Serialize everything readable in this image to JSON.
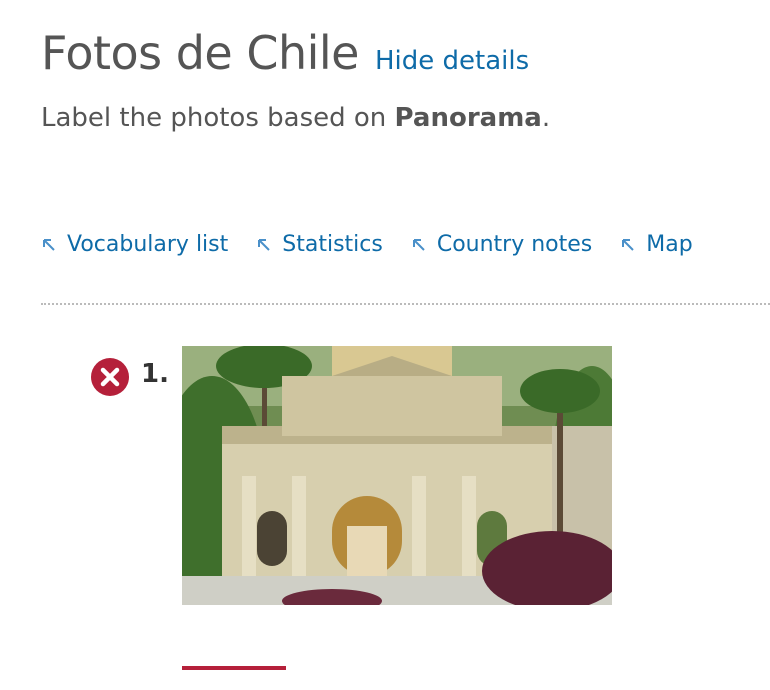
{
  "header": {
    "title": "Fotos de Chile",
    "hide_details": "Hide details"
  },
  "instruction": {
    "prefix": "Label the photos based on ",
    "bold": "Panorama",
    "suffix": "."
  },
  "resources": [
    {
      "label": "Vocabulary list",
      "icon": "arrow-up-left-icon"
    },
    {
      "label": "Statistics",
      "icon": "arrow-up-left-icon"
    },
    {
      "label": "Country notes",
      "icon": "arrow-up-left-icon"
    },
    {
      "label": "Map",
      "icon": "arrow-up-left-icon"
    }
  ],
  "questions": [
    {
      "number": "1.",
      "status": "incorrect",
      "status_icon": "x-circle-icon",
      "image_subject": "ornate palace facade with palm trees"
    }
  ],
  "colors": {
    "link": "#0e6ba8",
    "error": "#b5203a",
    "text": "#555555"
  }
}
